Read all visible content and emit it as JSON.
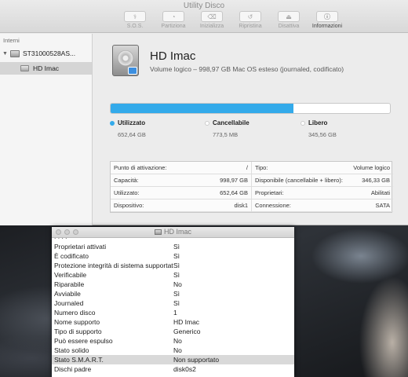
{
  "window": {
    "title": "Utility Disco"
  },
  "toolbar": [
    {
      "label": "S.O.S.",
      "icon": "stethoscope-icon",
      "glyph": "⚕"
    },
    {
      "label": "Partiziona",
      "icon": "partition-icon",
      "glyph": "◔"
    },
    {
      "label": "Inizializza",
      "icon": "erase-icon",
      "glyph": "⌫"
    },
    {
      "label": "Ripristina",
      "icon": "restore-icon",
      "glyph": "↺"
    },
    {
      "label": "Disattiva",
      "icon": "unmount-icon",
      "glyph": "⏏"
    },
    {
      "label": "Informazioni",
      "icon": "info-icon",
      "glyph": "ⓘ"
    }
  ],
  "sidebar": {
    "section": "Interni",
    "disk": "ST31000528AS...",
    "volume": "HD Imac"
  },
  "volume": {
    "name": "HD Imac",
    "description": "Volume logico – 998,97 GB Mac OS esteso (journaled, codificato)"
  },
  "usage": {
    "used_fraction": 0.6534,
    "used_color": "#33aaea",
    "used_label": "Utilizzato",
    "used_value": "652,64 GB",
    "purgeable_label": "Cancellabile",
    "purgeable_value": "773,5 MB",
    "free_label": "Libero",
    "free_value": "345,56 GB"
  },
  "info": {
    "left": [
      {
        "k": "Punto di attivazione:",
        "v": "/"
      },
      {
        "k": "Capacità:",
        "v": "998,97 GB"
      },
      {
        "k": "Utilizzato:",
        "v": "652,64 GB"
      },
      {
        "k": "Dispositivo:",
        "v": "disk1"
      }
    ],
    "right": [
      {
        "k": "Tipo:",
        "v": "Volume logico"
      },
      {
        "k": "Disponibile (cancellabile + libero):",
        "v": "346,33 GB"
      },
      {
        "k": "Proprietari:",
        "v": "Abilitati"
      },
      {
        "k": "Connessione:",
        "v": "SATA"
      }
    ]
  },
  "info_window": {
    "title": "HD Imac",
    "rows": [
      {
        "k": "Proprietari attivati",
        "v": "Sì"
      },
      {
        "k": "È codificato",
        "v": "Sì"
      },
      {
        "k": "Protezione integrità di sistema supportata",
        "v": "Sì"
      },
      {
        "k": "Verificabile",
        "v": "Sì"
      },
      {
        "k": "Riparabile",
        "v": "No"
      },
      {
        "k": "Avviabile",
        "v": "Sì"
      },
      {
        "k": "Journaled",
        "v": "Sì"
      },
      {
        "k": "Numero disco",
        "v": "1"
      },
      {
        "k": "Nome supporto",
        "v": "HD Imac"
      },
      {
        "k": "Tipo di supporto",
        "v": "Generico"
      },
      {
        "k": "Può essere espulso",
        "v": "No"
      },
      {
        "k": "Stato solido",
        "v": "No"
      },
      {
        "k": "Stato S.M.A.R.T.",
        "v": "Non supportato"
      },
      {
        "k": "Dischi padre",
        "v": "disk0s2"
      }
    ],
    "selected_index": 12
  }
}
